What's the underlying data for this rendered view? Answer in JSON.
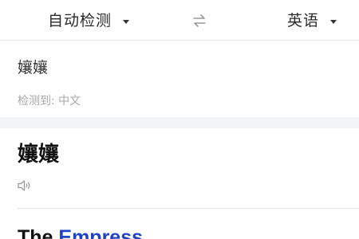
{
  "language_bar": {
    "source_language": "自动检测",
    "target_language": "英语",
    "swap_icon": "swap-arrows-icon",
    "caret_icon": "caret-down-icon"
  },
  "input": {
    "text": "孃孃",
    "detected_label": "检测到: 中文"
  },
  "result": {
    "headword": "孃孃",
    "speaker_icon": "speaker-icon",
    "translation_words": [
      {
        "text": "The ",
        "linked": false
      },
      {
        "text": "Empress",
        "linked": true
      }
    ]
  },
  "colors": {
    "link": "#1f43c6",
    "muted_text": "#a8a8a8",
    "band": "#f3f4f6"
  }
}
